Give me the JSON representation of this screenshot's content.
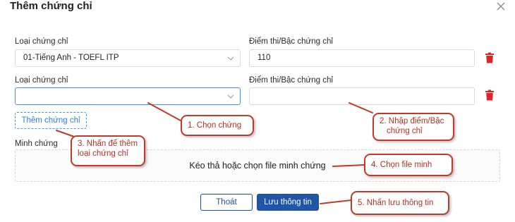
{
  "modal": {
    "title": "Thêm chứng chỉ"
  },
  "row1": {
    "cert_type_label": "Loại chứng chỉ",
    "cert_type_value": "01-Tiếng Anh - TOEFL ITP",
    "score_label": "Điểm thi/Bậc chứng chỉ",
    "score_value": "110"
  },
  "row2": {
    "cert_type_label": "Loại chứng chỉ",
    "cert_type_value": "",
    "score_label": "Điểm thi/Bậc chứng chỉ",
    "score_value": ""
  },
  "add_button_label": "Thêm chứng chỉ",
  "evidence": {
    "label": "Minh chứng",
    "dropzone_text": "Kéo thả hoặc chọn file minh chứng"
  },
  "footer": {
    "exit_label": "Thoát",
    "save_label": "Lưu thông tin"
  },
  "callouts": {
    "step1": "1. Chọn chứng",
    "step2_line1": "2. Nhập điểm/Bậc",
    "step2_line2": "chứng chỉ",
    "step3_line1": "3. Nhấn để thêm",
    "step3_line2": "loại chứng chỉ",
    "step4": "4. Chọn file minh",
    "step5": "5. Nhấn lưu thông tin"
  },
  "colors": {
    "primary": "#1f56a8",
    "accent": "#4a90d9",
    "danger": "#e02424",
    "callout": "#c0392b"
  }
}
